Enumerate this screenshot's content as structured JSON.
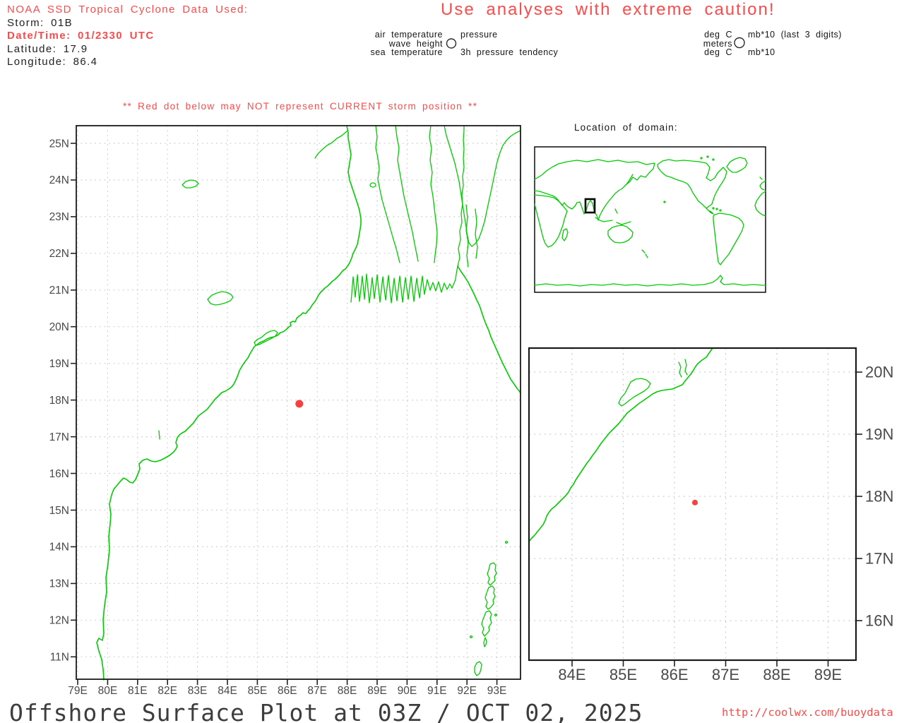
{
  "colors": {
    "coastline": "#00cc00",
    "storm_dot": "#f84040",
    "alert_text": "#fb4b4b",
    "grid": "#c9c9c9",
    "axis_text": "#4a4a4a",
    "border": "#1a1a1a"
  },
  "storm_info": {
    "line1": "NOAA SSD Tropical Cyclone Data Used:",
    "line2": "Storm: 01B",
    "line3": "Date/Time: 01/2330 UTC",
    "line4": "Latitude: 17.9",
    "line5": "Longitude: 86.4"
  },
  "caution_banner": "Use analyses with extreme caution!",
  "station_legend": {
    "air_temperature": "air temperature",
    "pressure": "pressure",
    "wave_height": "wave height",
    "sea_temperature": "sea temperature",
    "pressure_tendency": "3h pressure tendency"
  },
  "units_legend": {
    "air_temperature_units": "deg C",
    "pressure_units": "mb*10 (last 3 digits)",
    "wave_height_units": "meters",
    "sea_temperature_units": "deg C",
    "pressure_tendency_units": "mb*10"
  },
  "storm_warning": "** Red dot below may NOT represent CURRENT storm position **",
  "inset_map": {
    "title": "Location of domain:"
  },
  "main_map": {
    "x_ticks": [
      "79E",
      "80E",
      "81E",
      "82E",
      "83E",
      "84E",
      "85E",
      "86E",
      "87E",
      "88E",
      "89E",
      "90E",
      "91E",
      "92E",
      "93E"
    ],
    "y_ticks": [
      "25N",
      "24N",
      "23N",
      "22N",
      "21N",
      "20N",
      "19N",
      "18N",
      "17N",
      "16N",
      "15N",
      "14N",
      "13N",
      "12N",
      "11N"
    ],
    "storm": {
      "lon": 86.4,
      "lat": 17.9
    }
  },
  "zoom_map": {
    "x_ticks": [
      "84E",
      "85E",
      "86E",
      "87E",
      "88E",
      "89E"
    ],
    "y_ticks": [
      "20N",
      "19N",
      "18N",
      "17N",
      "16N"
    ],
    "storm": {
      "lon": 86.4,
      "lat": 17.9
    }
  },
  "footer": {
    "title": "Offshore Surface Plot at 03Z / OCT 02, 2025",
    "url": "http://coolwx.com/buoydata"
  }
}
